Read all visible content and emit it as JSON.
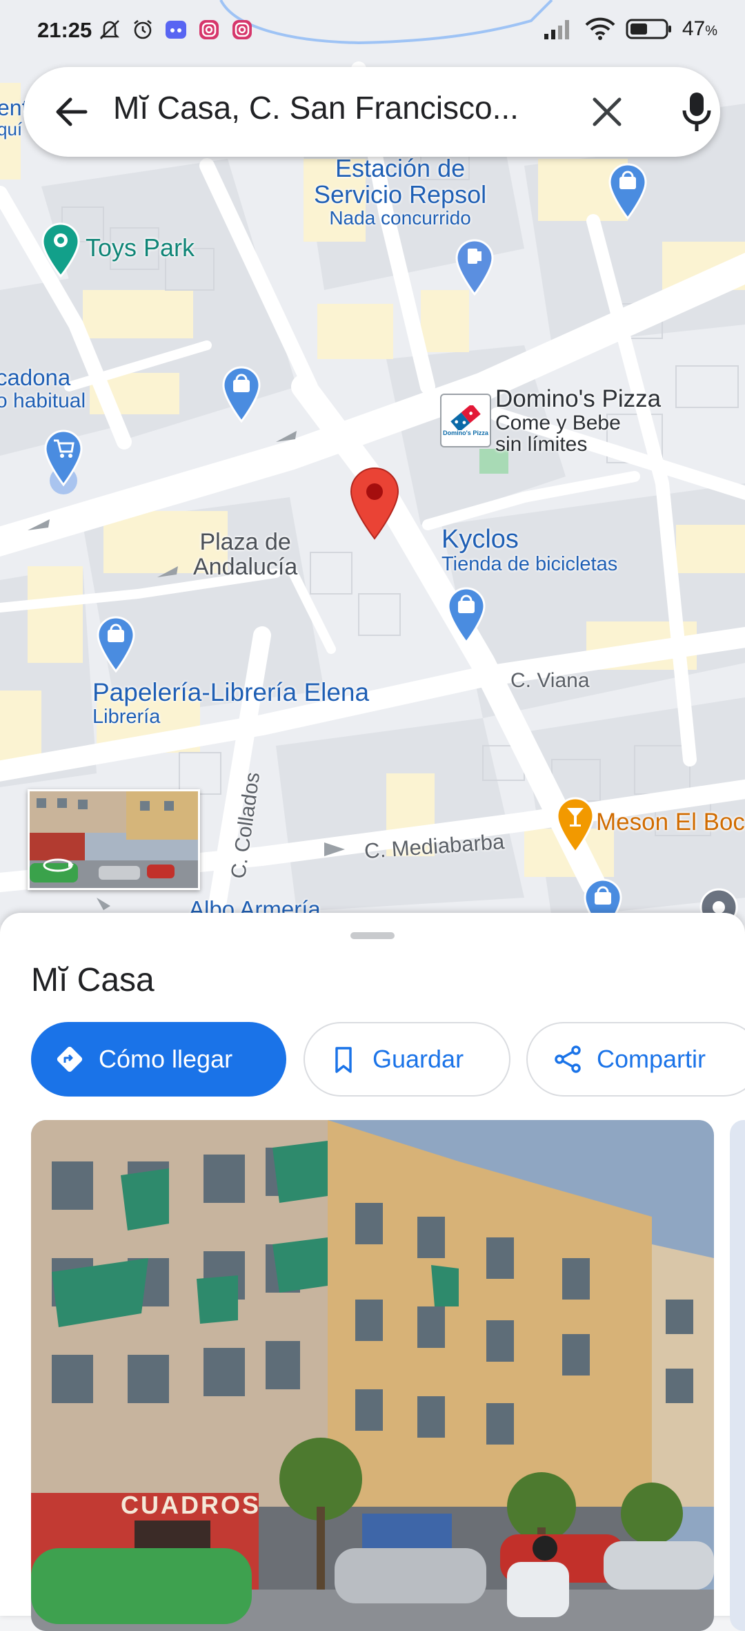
{
  "status_bar": {
    "time": "21:25",
    "battery": "47",
    "notification_icons": [
      "mute-icon",
      "alarm-icon",
      "discord-icon",
      "instagram-icon",
      "instagram-icon"
    ]
  },
  "search": {
    "query": "Mĭ Casa, C. San Francisco..."
  },
  "map": {
    "pois": {
      "repsol_name_line1": "Estación de",
      "repsol_name_line2": "Servicio Repsol",
      "repsol_sub": "Nada concurrido",
      "toys_park": "Toys Park",
      "mercadona_line1": "cadona",
      "mercadona_line2": "o habitual",
      "dominos_name": "Domino's Pizza",
      "dominos_sub1": "Come y Bebe",
      "dominos_sub2": "sin límites",
      "dominos_logo_text": "Domino's Pizza",
      "kyclos_name": "Kyclos",
      "kyclos_sub": "Tienda de bicicletas",
      "papeleria_name": "Papelería-Librería Elena",
      "papeleria_sub": "Librería",
      "meson": "Meson El Boc",
      "albo": "Albo Armería",
      "left_edge_line1": "ent",
      "left_edge_line2": "quí"
    },
    "places": {
      "plaza_line1": "Plaza de",
      "plaza_line2": "Andalucía"
    },
    "streets": {
      "viana": "C. Viana",
      "collados": "C. Collados",
      "mediabarba": "C. Mediabarba"
    }
  },
  "place_sheet": {
    "title": "Mĭ Casa",
    "buttons": {
      "directions": "Cómo llegar",
      "save": "Guardar",
      "share": "Compartir"
    },
    "photo_sign": "CUADROS"
  },
  "colors": {
    "accent": "#1a73e8",
    "pin_red": "#ea4335",
    "poi_blue": "#4a8ce0",
    "poi_teal": "#12a08a",
    "poi_orange": "#f29900"
  }
}
